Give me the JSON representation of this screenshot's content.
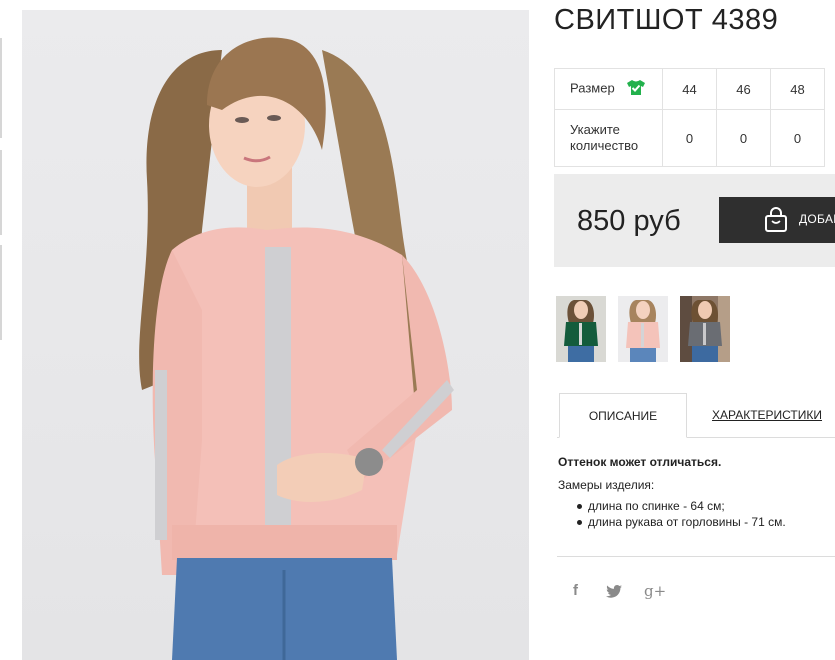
{
  "product": {
    "title": "СВИТШОТ 4389"
  },
  "sizes": {
    "size_label": "Размер",
    "size_icon": "tshirt-check-icon",
    "size_icon_color": "#22b14c",
    "values": [
      "44",
      "46",
      "48"
    ],
    "quantity_label": "Укажите количество",
    "quantities": [
      "0",
      "0",
      "0"
    ]
  },
  "price": {
    "amount": "850 руб",
    "add_button_label": "ДОБАВИТЬ В КОРЗИНУ",
    "add_button_icon": "shopping-bag-icon"
  },
  "thumbnails": [
    {
      "color": "dark green"
    },
    {
      "color": "pink"
    },
    {
      "color": "grey"
    }
  ],
  "tabs": {
    "description": "ОПИСАНИЕ",
    "characteristics": "ХАРАКТЕРИСТИКИ"
  },
  "description": {
    "note": "Оттенок может отличаться.",
    "measurements_heading": "Замеры изделия:",
    "items": [
      "длина по спинке - 64 см;",
      "длина рукава от горловины - 71 см."
    ]
  },
  "social": {
    "facebook": "f",
    "twitter": "twitter-bird-icon",
    "google_plus": "g+"
  }
}
